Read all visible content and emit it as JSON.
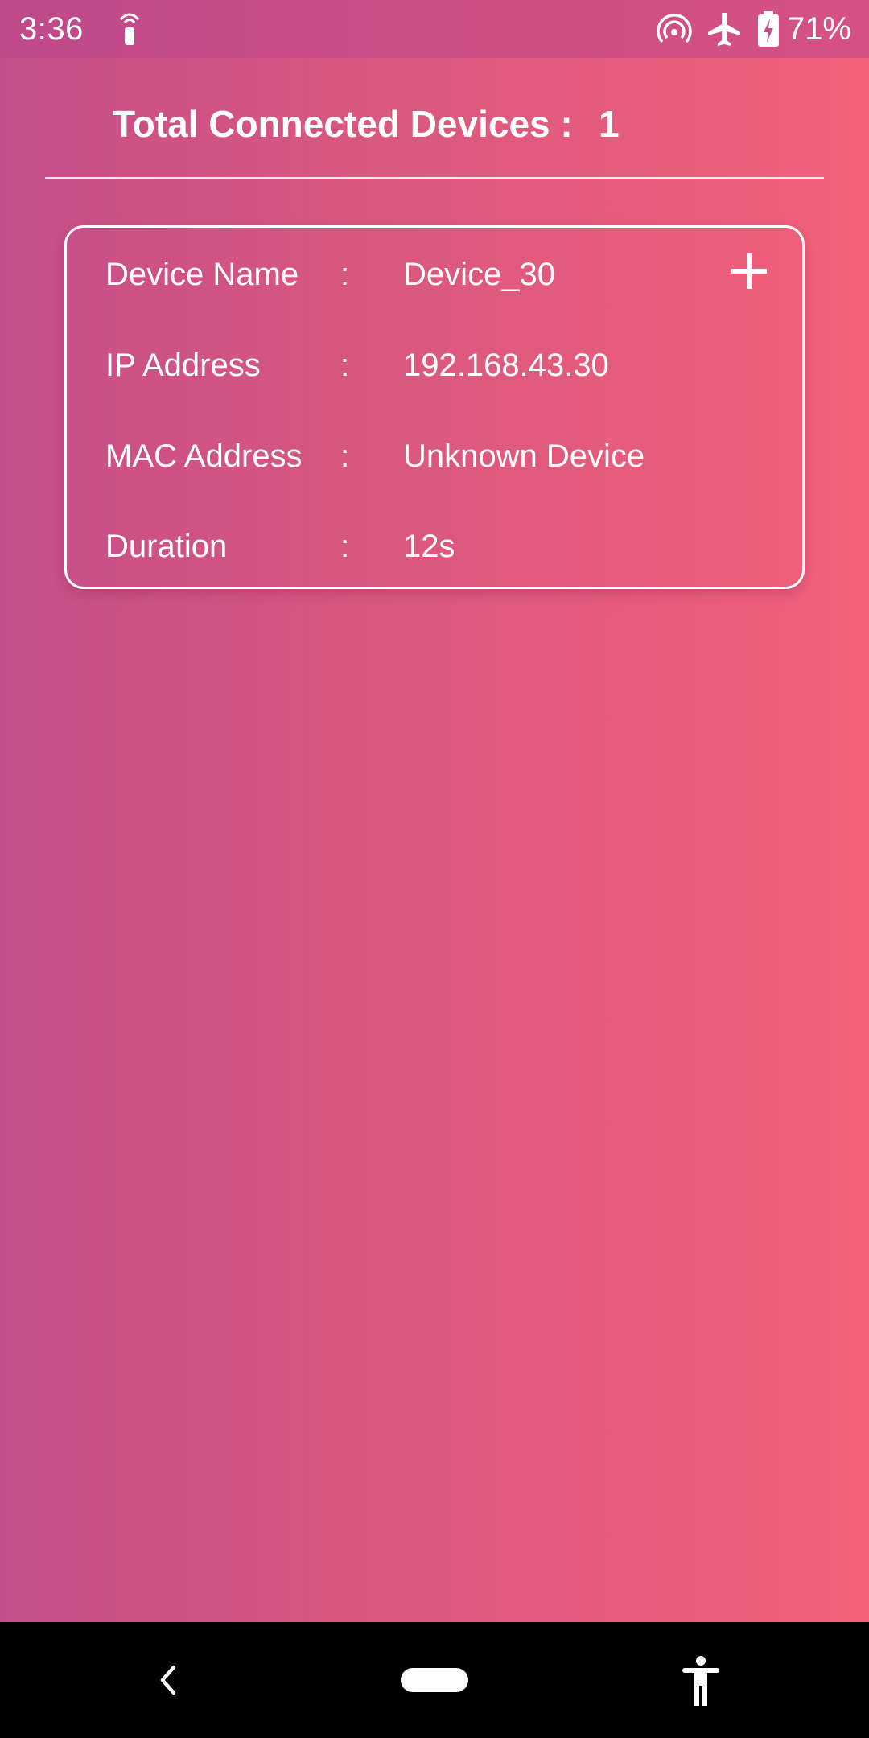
{
  "status_bar": {
    "time": "3:36",
    "battery_percent": "71%",
    "icons": [
      "hotspot-icon",
      "wifi-tethering-icon",
      "airplane-mode-icon",
      "battery-charging-icon"
    ]
  },
  "header": {
    "title": "Total Connected Devices :",
    "count": "1"
  },
  "device": {
    "rows": [
      {
        "label": "Device Name",
        "sep": ":",
        "value": "Device_30"
      },
      {
        "label": "IP Address",
        "sep": ":",
        "value": "192.168.43.30"
      },
      {
        "label": "MAC Address",
        "sep": ":",
        "value": "Unknown Device"
      },
      {
        "label": "Duration",
        "sep": ":",
        "value": "12s"
      }
    ],
    "action_icon": "plus-icon"
  },
  "nav_bar": {
    "icons": [
      "back-icon",
      "home-pill",
      "accessibility-icon"
    ]
  },
  "colors": {
    "gradient_start": "#c54e8a",
    "gradient_end": "#f3607a",
    "text": "#ffffff",
    "nav_background": "#000000"
  }
}
